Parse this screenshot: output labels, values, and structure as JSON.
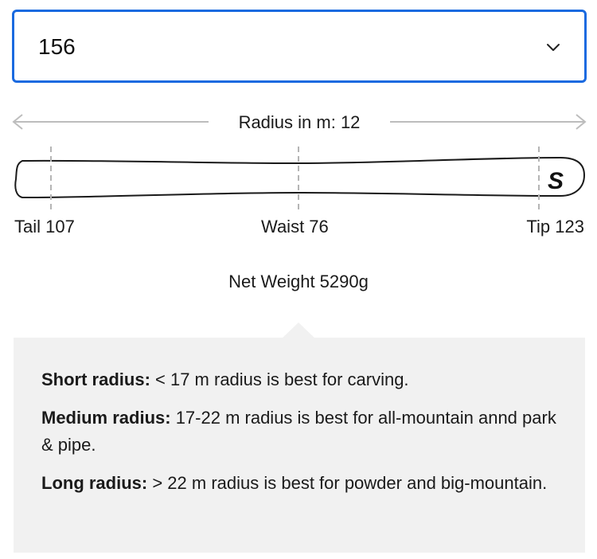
{
  "size_select": {
    "value": "156",
    "icon": "chevron-down-icon"
  },
  "radius": {
    "label": "Radius in m: 12",
    "left_icon": "arrow-left-icon",
    "right_icon": "arrow-right-icon"
  },
  "ski": {
    "logo": "S",
    "tail_label": "Tail 107",
    "waist_label": "Waist 76",
    "tip_label": "Tip 123"
  },
  "weight": "Net Weight 5290g",
  "info": {
    "items": [
      {
        "term": "Short radius:",
        "desc": " < 17 m radius is best for carving."
      },
      {
        "term": "Medium radius:",
        "desc": " 17-22 m radius is best for all-mountain annd park & pipe."
      },
      {
        "term": "Long radius:",
        "desc": " > 22 m radius is best for powder and big-mountain."
      }
    ]
  },
  "colors": {
    "accent": "#1a6ae0",
    "panel_bg": "#f1f1f1",
    "guide_gray": "#b5b5b5"
  }
}
